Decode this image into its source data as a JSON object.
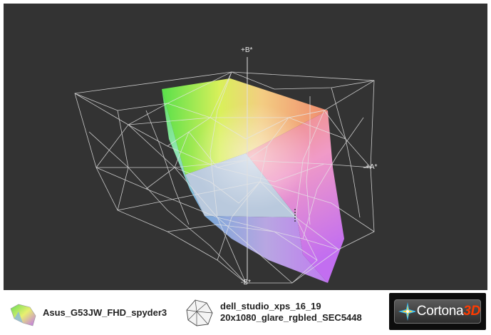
{
  "viewport": {
    "background": "#333333",
    "axis_labels": {
      "plus_b": "+B*",
      "minus_b": "-B*",
      "plus_a": "+A*"
    }
  },
  "legend": {
    "items": [
      {
        "label": "Asus_G53JW_FHD_spyder3",
        "icon": "color-gamut-solid-icon"
      },
      {
        "label_line1": "dell_studio_xps_16_19",
        "label_line2": "20x1080_glare_rgbled_SEC5448",
        "icon": "wireframe-gamut-icon"
      }
    ]
  },
  "brand": {
    "name": "Cortona",
    "suffix": "3D",
    "icon": "cortona-star-icon",
    "accent_color": "#ff3b00"
  }
}
